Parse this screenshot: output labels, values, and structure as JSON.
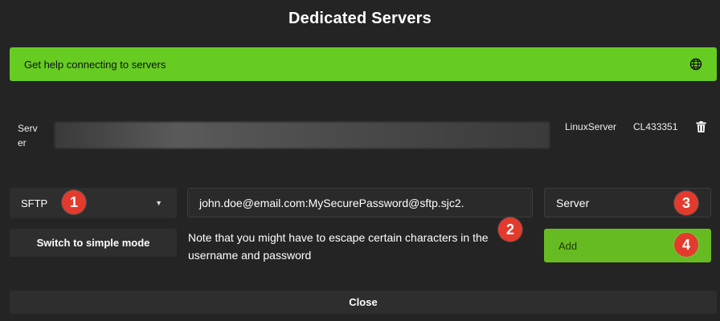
{
  "title": "Dedicated Servers",
  "help_bar": {
    "label": "Get help connecting to servers",
    "icon": "globe-icon",
    "color": "#66cc22"
  },
  "server": {
    "label": "Server",
    "type": "LinuxServer",
    "id": "CL433351",
    "delete_icon": "trash-icon"
  },
  "protocol_select": {
    "value": "SFTP",
    "icon": "chevron-down-icon"
  },
  "switch_mode_label": "Switch to simple mode",
  "connection_input": {
    "value": "john.doe@email.com:MySecurePassword@sftp.sjc2."
  },
  "note": "Note that you might have to escape certain characters in the username and password",
  "name_input": {
    "value": "Server"
  },
  "add_label": "Add",
  "close_label": "Close",
  "badges": [
    "1",
    "2",
    "3",
    "4"
  ],
  "accent_color": "#66bb22",
  "badge_color": "#e23b2e"
}
